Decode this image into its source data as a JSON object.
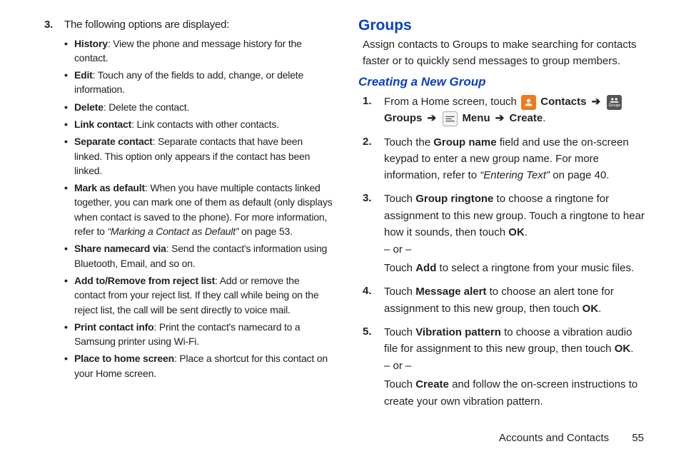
{
  "left": {
    "num3": "3.",
    "intro": "The following options are displayed:",
    "bullets": [
      {
        "label": "History",
        "rest": ": View the phone and message history for the contact."
      },
      {
        "label": "Edit",
        "rest": ": Touch any of the fields to add, change, or delete information."
      },
      {
        "label": "Delete",
        "rest": ": Delete the contact."
      },
      {
        "label": "Link contact",
        "rest": ": Link contacts with other contacts."
      },
      {
        "label": "Separate contact",
        "rest": ": Separate contacts that have been linked. This option only appears if the contact has been linked."
      },
      {
        "label": "Mark as default",
        "rest_pre": ": When you have multiple contacts linked together, you can mark one of them as default (only displays when contact is saved to the phone). For more information, refer to ",
        "ital": "“Marking a Contact as Default”",
        "rest_post": " on page 53."
      },
      {
        "label": "Share namecard via",
        "rest": ": Send the contact's information using Bluetooth, Email, and so on."
      },
      {
        "label": "Add to/Remove from reject list",
        "rest": ": Add or remove the contact from your reject list. If they call while being on the reject list, the call will be sent directly to voice mail."
      },
      {
        "label": "Print contact info",
        "rest": ": Print the contact's namecard to a Samsung printer using Wi-Fi."
      },
      {
        "label": " Place to home screen",
        "rest": ": Place a shortcut for this contact on your Home screen."
      }
    ]
  },
  "right": {
    "groups_h": "Groups",
    "groups_p": "Assign contacts to Groups to make searching for contacts faster or to quickly send messages to group members.",
    "create_h": "Creating a New Group",
    "s1_num": "1.",
    "s1_a": "From a Home screen, touch ",
    "s1_contacts": "Contacts",
    "s1_groups": "Groups",
    "s1_menu": "Menu",
    "s1_create": "Create",
    "arrow": "➔",
    "groups_label": "Groups",
    "s2_num": "2.",
    "s2_a": "Touch the ",
    "s2_b": "Group name",
    "s2_c": " field and use the on-screen keypad to enter a new group name. For more information, refer to ",
    "s2_ital": "“Entering Text”",
    "s2_d": " on page 40.",
    "s3_num": "3.",
    "s3_a": "Touch ",
    "s3_b": "Group ringtone",
    "s3_c": " to choose a ringtone for assignment to this new group. Touch a ringtone to hear how it sounds, then touch ",
    "s3_ok": "OK",
    "s3_d": ".",
    "or": "– or –",
    "s3_e": "Touch ",
    "s3_add": "Add",
    "s3_f": " to select a ringtone from your music files.",
    "s4_num": "4.",
    "s4_a": "Touch ",
    "s4_b": "Message alert",
    "s4_c": " to choose an alert tone for assignment to this new group, then touch ",
    "s4_ok": "OK",
    "s4_d": ".",
    "s5_num": "5.",
    "s5_a": "Touch ",
    "s5_b": "Vibration pattern",
    "s5_c": " to choose a vibration audio file for assignment to this new group, then touch ",
    "s5_ok": "OK",
    "s5_d": ".",
    "s5_e": "Touch ",
    "s5_create": "Create",
    "s5_f": " and follow the on-screen instructions to create your own vibration pattern."
  },
  "footer": {
    "section": "Accounts and Contacts",
    "page": "55"
  }
}
